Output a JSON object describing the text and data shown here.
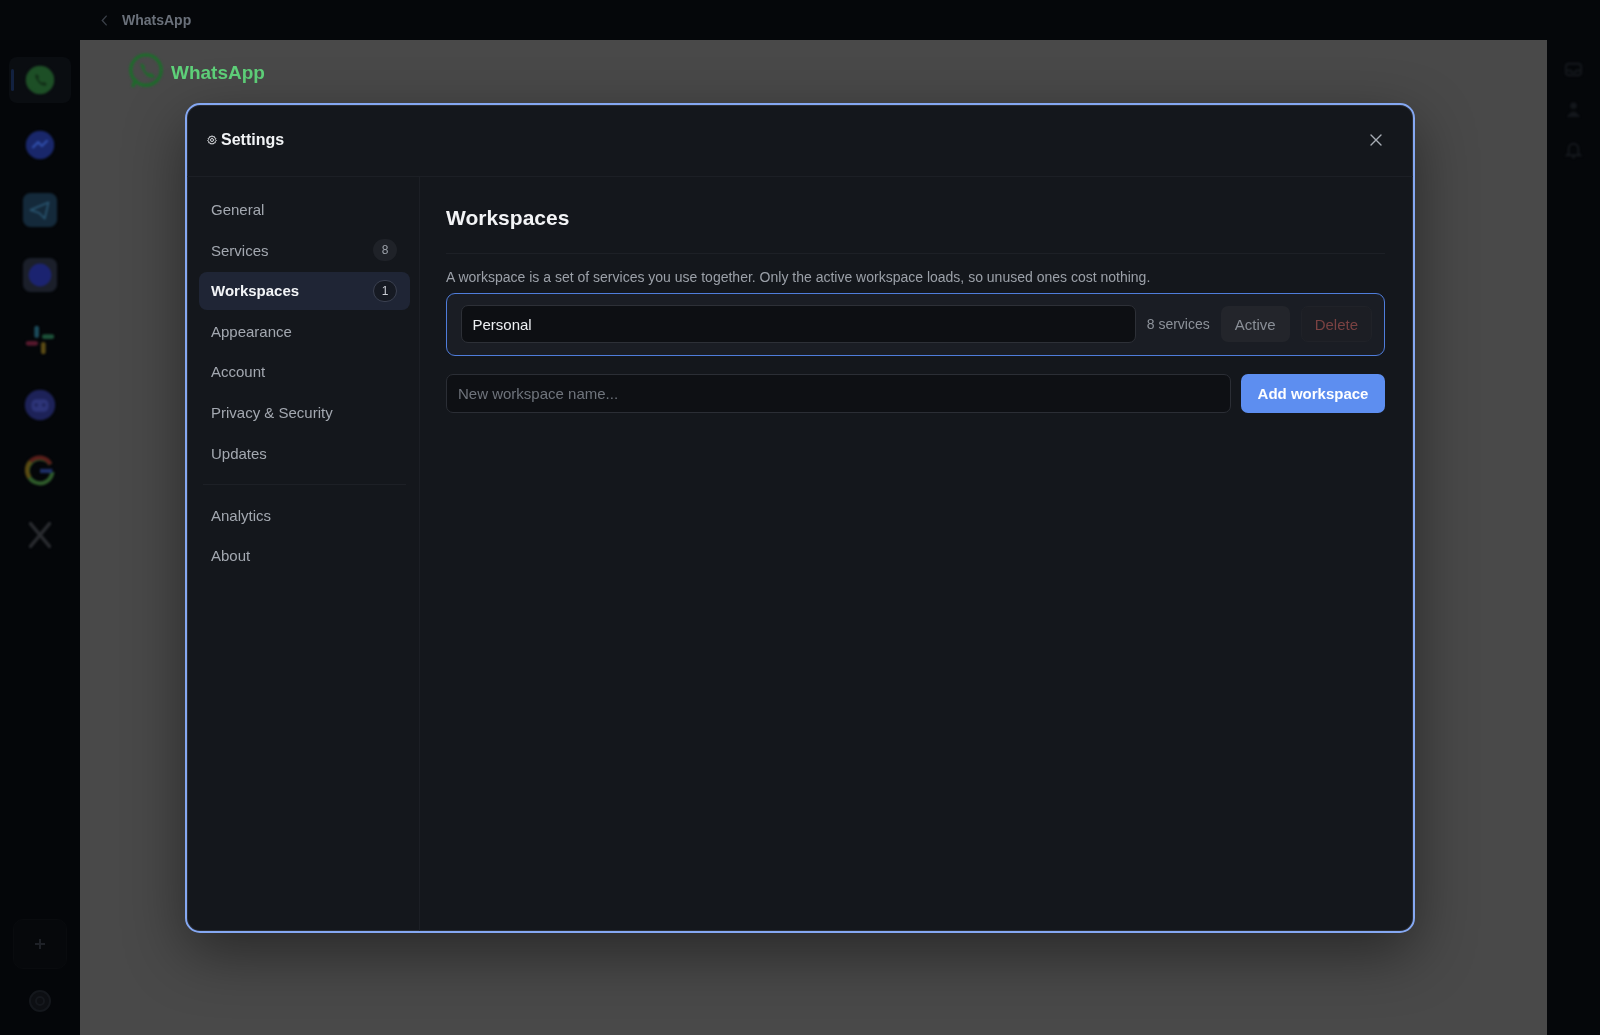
{
  "topbar": {
    "title": "WhatsApp"
  },
  "services": [
    {
      "selected": true
    },
    {
      "selected": false
    },
    {
      "selected": false
    },
    {
      "selected": false
    },
    {
      "selected": false
    },
    {
      "selected": false
    },
    {
      "selected": false
    },
    {
      "selected": false
    }
  ],
  "service_page": {
    "brand": "WhatsApp"
  },
  "settings": {
    "title": "Settings",
    "nav_groups": [
      {
        "items": [
          {
            "label": "General",
            "selected": false
          },
          {
            "label": "Services",
            "badge": "8",
            "selected": false
          },
          {
            "label": "Workspaces",
            "badge": "1",
            "selected": true
          },
          {
            "label": "Appearance",
            "selected": false
          },
          {
            "label": "Account",
            "selected": false
          },
          {
            "label": "Privacy & Security",
            "selected": false
          },
          {
            "label": "Updates",
            "selected": false
          }
        ]
      },
      {
        "items": [
          {
            "label": "Analytics",
            "selected": false
          },
          {
            "label": "About",
            "selected": false
          }
        ]
      }
    ],
    "panel": {
      "title": "Workspaces",
      "description": "A workspace is a set of services you use together. Only the active workspace loads, so unused ones cost nothing.",
      "workspaces": [
        {
          "name": "Personal",
          "services": "8 services",
          "active": true,
          "actions": [
            {
              "kind": "activate",
              "label": "Active",
              "disabled": true
            },
            {
              "kind": "delete",
              "label": "Delete",
              "disabled": true
            }
          ]
        }
      ],
      "new_workspace": {
        "placeholder": "New workspace name...",
        "button": "Add workspace"
      }
    }
  }
}
